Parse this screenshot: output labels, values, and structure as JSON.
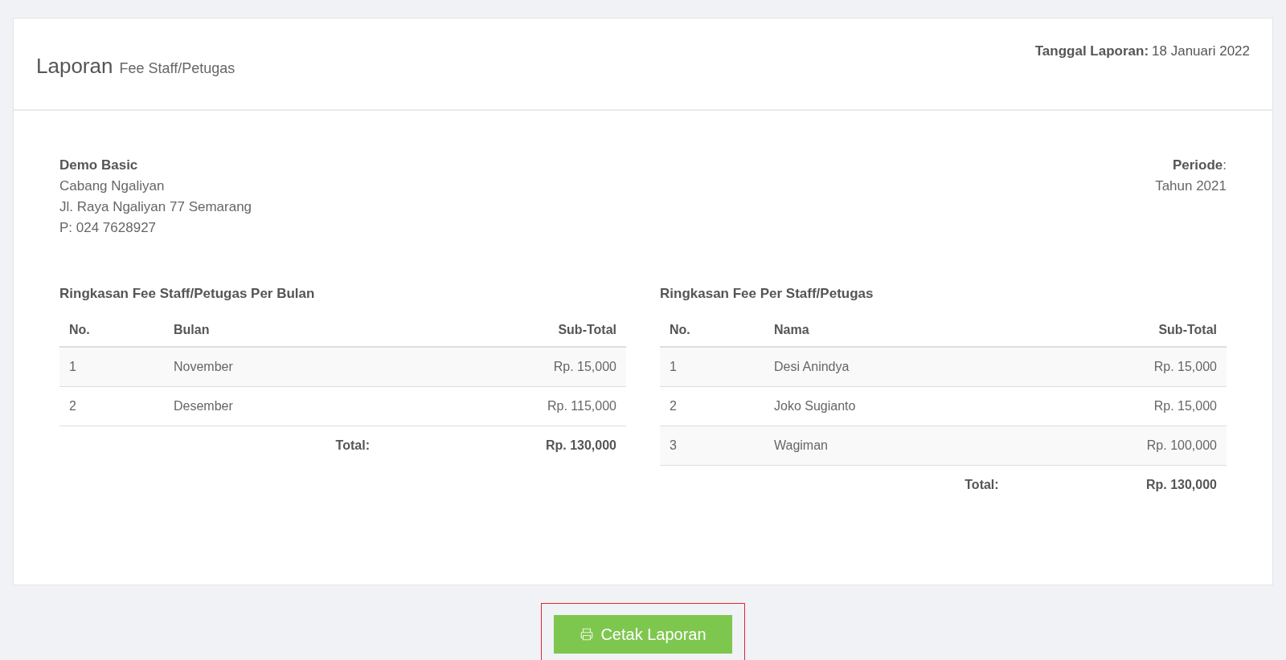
{
  "header": {
    "title": "Laporan",
    "subtitle": "Fee Staff/Petugas",
    "date_label": "Tanggal Laporan:",
    "date_value": "18 Januari 2022"
  },
  "company": {
    "name": "Demo Basic",
    "lines": [
      "Cabang Ngaliyan",
      "Jl. Raya Ngaliyan 77 Semarang",
      "P: 024 7628927"
    ]
  },
  "period": {
    "label": "Periode",
    "colon": ":",
    "value": "Tahun 2021"
  },
  "tables": [
    {
      "title": "Ringkasan Fee Staff/Petugas Per Bulan",
      "columns": [
        "No.",
        "Bulan",
        "Sub-Total"
      ],
      "rows": [
        {
          "cells": [
            "1",
            "November",
            "Rp. 15,000"
          ]
        },
        {
          "cells": [
            "2",
            "Desember",
            "Rp. 115,000"
          ]
        }
      ],
      "total_label": "Total:",
      "total_value": "Rp. 130,000"
    },
    {
      "title": "Ringkasan Fee Per Staff/Petugas",
      "columns": [
        "No.",
        "Nama",
        "Sub-Total"
      ],
      "rows": [
        {
          "cells": [
            "1",
            "Desi Anindya",
            "Rp. 15,000"
          ]
        },
        {
          "cells": [
            "2",
            "Joko Sugianto",
            "Rp. 15,000"
          ]
        },
        {
          "cells": [
            "3",
            "Wagiman",
            "Rp. 100,000"
          ]
        }
      ],
      "total_label": "Total:",
      "total_value": "Rp. 130,000"
    }
  ],
  "print_button": {
    "label": "Cetak Laporan",
    "highlighted": true
  }
}
